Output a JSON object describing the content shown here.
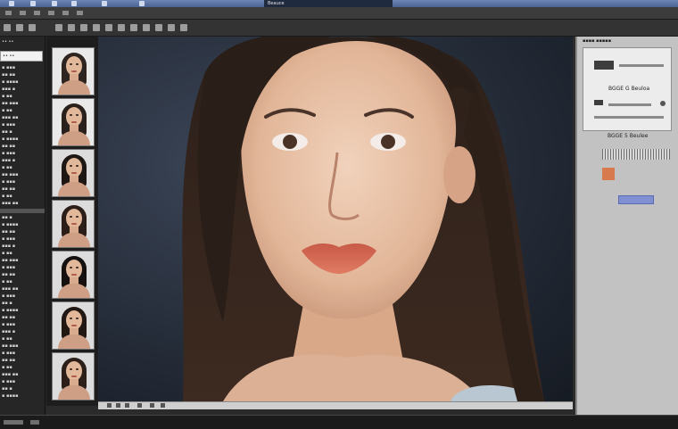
{
  "window": {
    "title": "Beauce"
  },
  "sidebar": {
    "header": "•• ••",
    "search_value": "•• ••",
    "rows": [
      "▪ ▪▪▪",
      "▪▪ ▪▪",
      "▪ ▪▪▪▪",
      "▪▪▪ ▪",
      "▪ ▪▪",
      "▪▪ ▪▪▪",
      "▪ ▪▪",
      "▪▪▪ ▪▪",
      "▪ ▪▪▪",
      "▪▪ ▪",
      "▪ ▪▪▪▪",
      "▪▪ ▪▪",
      "▪ ▪▪▪",
      "▪▪▪ ▪",
      "▪ ▪▪",
      "▪▪ ▪▪▪",
      "▪ ▪▪▪",
      "▪▪ ▪▪",
      "▪ ▪▪",
      "▪▪▪ ▪▪",
      "▪ ▪▪▪",
      "▪▪ ▪",
      "▪ ▪▪▪▪",
      "▪▪ ▪▪",
      "▪ ▪▪▪",
      "▪▪▪ ▪",
      "▪ ▪▪",
      "▪▪ ▪▪▪",
      "▪ ▪▪▪",
      "▪▪ ▪▪",
      "▪ ▪▪",
      "▪▪▪ ▪▪",
      "▪ ▪▪▪",
      "▪▪ ▪",
      "▪ ▪▪▪▪",
      "▪▪ ▪▪",
      "▪ ▪▪▪",
      "▪▪▪ ▪",
      "▪ ▪▪",
      "▪▪ ▪▪▪",
      "▪ ▪▪▪",
      "▪▪ ▪▪",
      "▪ ▪▪",
      "▪▪▪ ▪▪",
      "▪ ▪▪▪",
      "▪▪ ▪",
      "▪ ▪▪▪▪"
    ]
  },
  "thumbnails": [
    {
      "hair": "#2e2420",
      "style": "light"
    },
    {
      "hair": "#2a201c",
      "style": "light"
    },
    {
      "hair": "#1f1714",
      "style": "white"
    },
    {
      "hair": "#2b1d18",
      "style": "white"
    },
    {
      "hair": "#16110f",
      "style": "white"
    },
    {
      "hair": "#221813",
      "style": "white"
    },
    {
      "hair": "#2c1f19",
      "style": "white"
    }
  ],
  "right_panel": {
    "title": "▪▪▪▪ ▪▪▪▪▪",
    "label_1": "BGGE G Beuloa",
    "label_2": "BGGE 5 Beulee",
    "accent": "#7f8fd2"
  },
  "colors": {
    "skin": "#e8c2a8",
    "lips": "#d7644f",
    "hair": "#231914",
    "background": "#232a36"
  }
}
